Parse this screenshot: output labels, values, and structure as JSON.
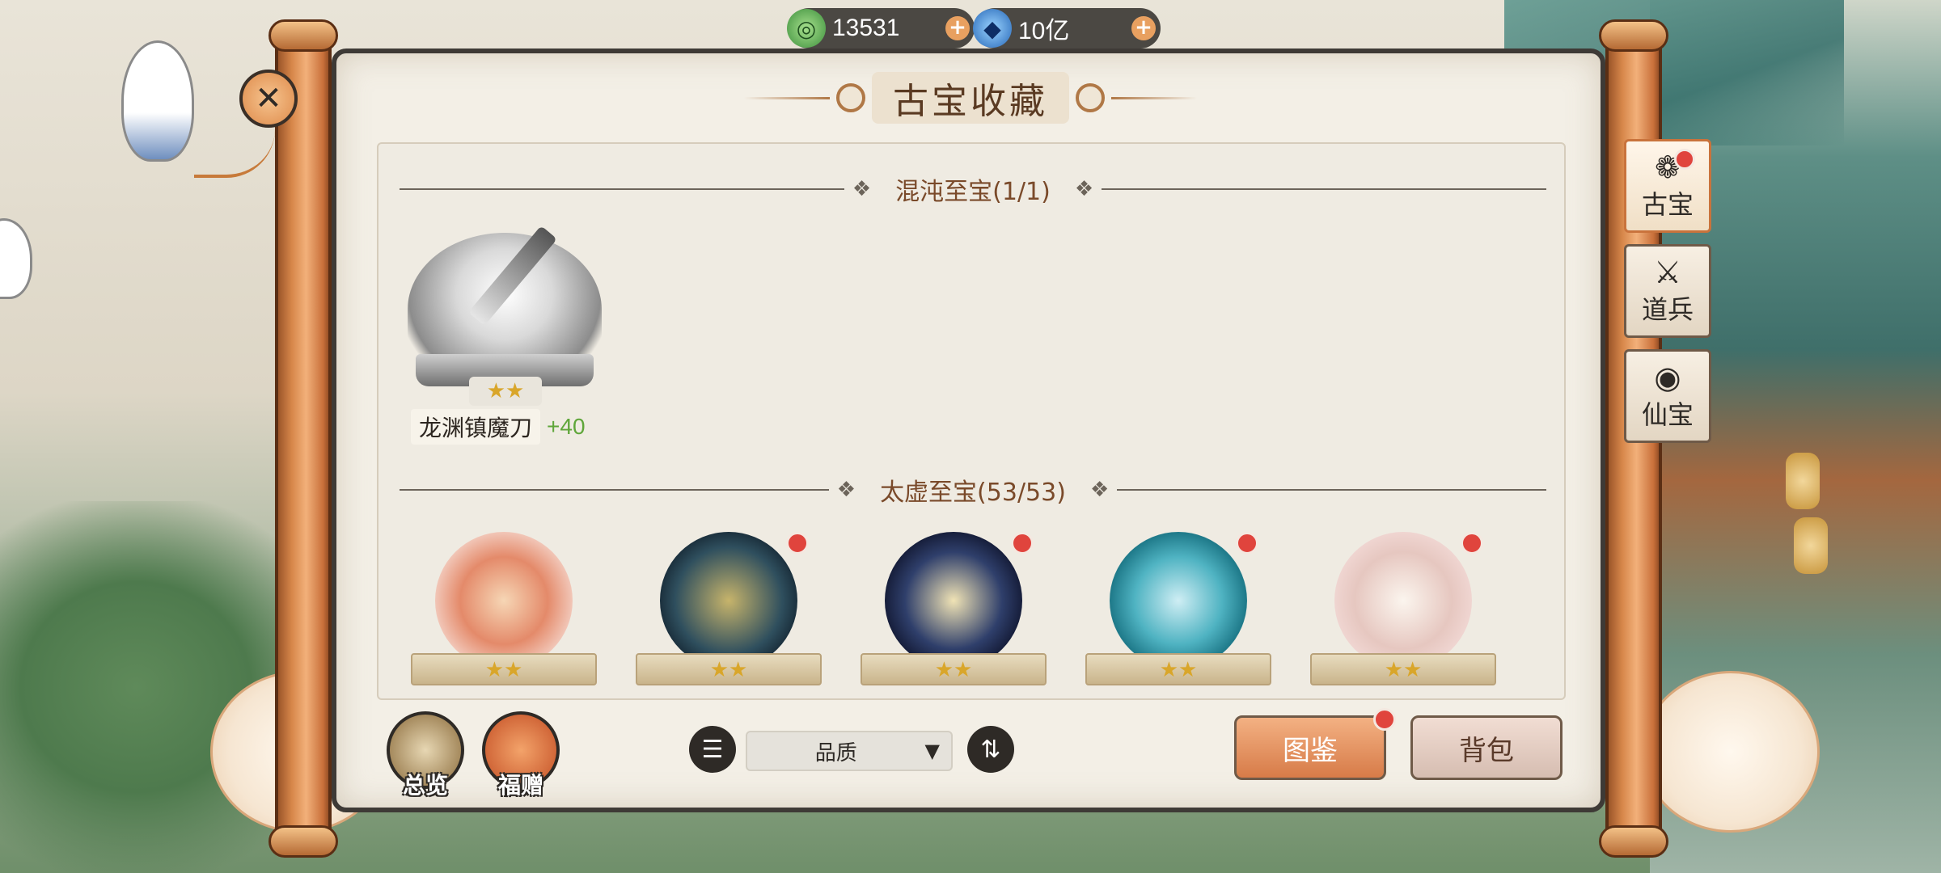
{
  "currencies": {
    "jade": {
      "value": "13531",
      "icon": "jade-coin-icon"
    },
    "crystal": {
      "value": "10亿",
      "icon": "blue-crystal-icon"
    },
    "plus": "+"
  },
  "title": "古宝收藏",
  "sections": {
    "chaos": {
      "label": "混沌至宝(1/1)",
      "items": [
        {
          "name": "龙渊镇魔刀",
          "bonus": "+40",
          "stars": 2
        }
      ]
    },
    "void": {
      "label": "太虚至宝(53/53)",
      "items": [
        {
          "stars": 2,
          "badge": false,
          "colors": "red-flower-orb"
        },
        {
          "stars": 2,
          "badge": true,
          "colors": "gold-turtle-orb"
        },
        {
          "stars": 2,
          "badge": true,
          "colors": "night-staff-orb"
        },
        {
          "stars": 2,
          "badge": true,
          "colors": "cyan-dragon-orb"
        },
        {
          "stars": 2,
          "badge": true,
          "colors": "pink-fan-orb"
        }
      ]
    }
  },
  "bottom": {
    "overview_label": "总览",
    "gift_label": "福赠",
    "sort_value": "品质",
    "codex_label": "图鉴",
    "bag_label": "背包"
  },
  "side_tabs": [
    {
      "label": "古宝",
      "icon": "flower-icon",
      "active": true,
      "badge": true
    },
    {
      "label": "道兵",
      "icon": "weapon-icon",
      "active": false,
      "badge": false
    },
    {
      "label": "仙宝",
      "icon": "eye-icon",
      "active": false,
      "badge": false
    }
  ],
  "colors": {
    "accent": "#d77b48",
    "badge": "#e0443d",
    "bonus": "#5fa63a",
    "star": "#d9a62a"
  }
}
